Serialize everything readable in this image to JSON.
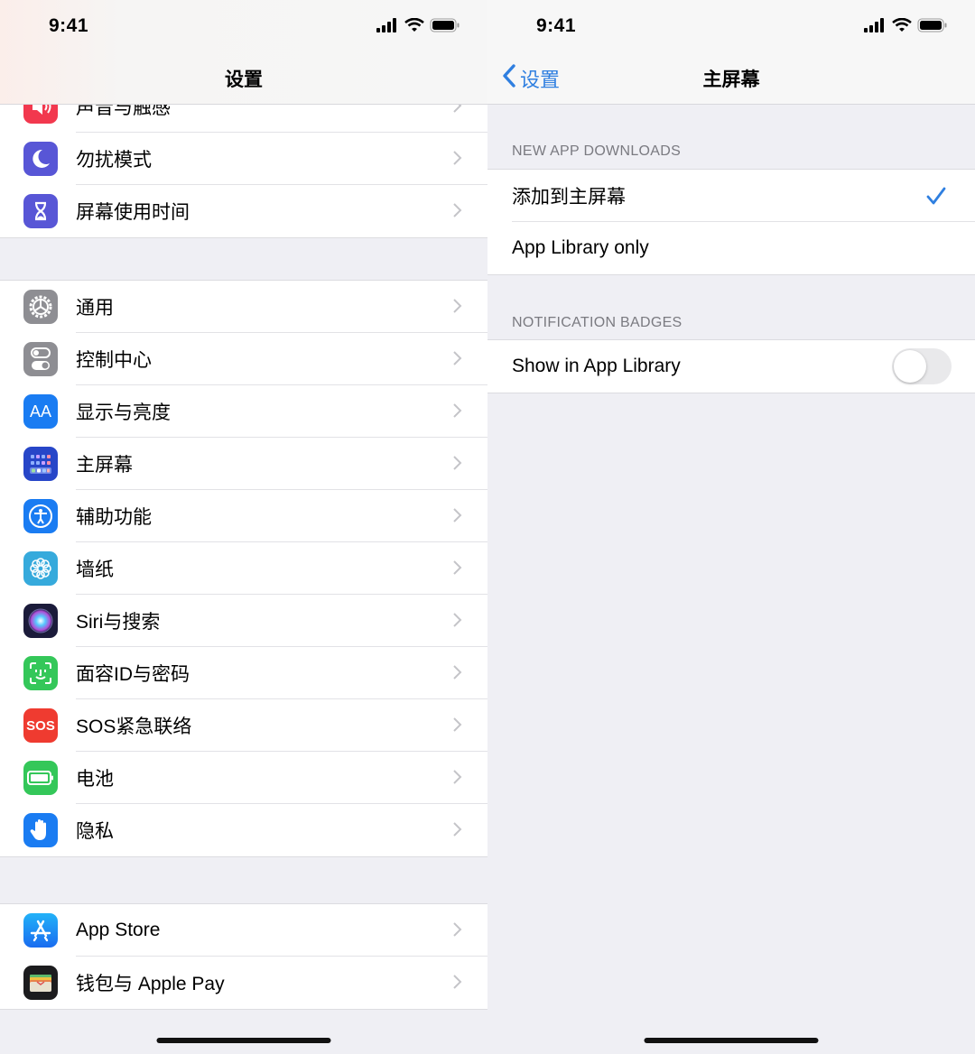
{
  "status_bar": {
    "time": "9:41"
  },
  "left": {
    "nav_title": "设置",
    "groups": [
      {
        "items": [
          {
            "label": "声音与触感",
            "icon": "speaker-icon",
            "color": "#f2384e"
          },
          {
            "label": "勿扰模式",
            "icon": "moon-icon",
            "color": "#5856d6"
          },
          {
            "label": "屏幕使用时间",
            "icon": "hourglass-icon",
            "color": "#5856d6"
          }
        ]
      },
      {
        "items": [
          {
            "label": "通用",
            "icon": "gear-icon",
            "color": "#8e8e93"
          },
          {
            "label": "控制中心",
            "icon": "switches-icon",
            "color": "#8e8e93"
          },
          {
            "label": "显示与亮度",
            "icon": "text-size-icon",
            "color": "#1a7cf2",
            "icon_text": "AA"
          },
          {
            "label": "主屏幕",
            "icon": "home-screen-grid-icon",
            "color": "#2746c8"
          },
          {
            "label": "辅助功能",
            "icon": "accessibility-icon",
            "color": "#1a7cf2"
          },
          {
            "label": "墙纸",
            "icon": "flower-icon",
            "color": "#36aadc"
          },
          {
            "label": "Siri与搜索",
            "icon": "siri-icon",
            "color": "#1b1b3a"
          },
          {
            "label": "面容ID与密码",
            "icon": "face-id-icon",
            "color": "#34c759"
          },
          {
            "label": "SOS紧急联络",
            "icon": "sos-icon",
            "color": "#ef3b30",
            "icon_text": "SOS"
          },
          {
            "label": "电池",
            "icon": "battery-icon",
            "color": "#34c759"
          },
          {
            "label": "隐私",
            "icon": "hand-icon",
            "color": "#1a7cf2"
          }
        ]
      },
      {
        "items": [
          {
            "label": "App Store",
            "icon": "app-store-icon",
            "color": "#1a8cf0"
          },
          {
            "label": "钱包与 Apple Pay",
            "icon": "wallet-icon",
            "color": "#1c1c1e"
          }
        ]
      }
    ]
  },
  "right": {
    "back_label": "设置",
    "nav_title": "主屏幕",
    "sections": [
      {
        "header": "NEW APP DOWNLOADS",
        "options": [
          {
            "label": "添加到主屏幕",
            "checked": true
          },
          {
            "label": "App Library only",
            "checked": false
          }
        ]
      },
      {
        "header": "NOTIFICATION BADGES",
        "options": [
          {
            "label": "Show in App Library",
            "toggle": false
          }
        ]
      }
    ]
  },
  "colors": {
    "accent": "#2f7fe0",
    "group_bg": "#efeff4"
  }
}
